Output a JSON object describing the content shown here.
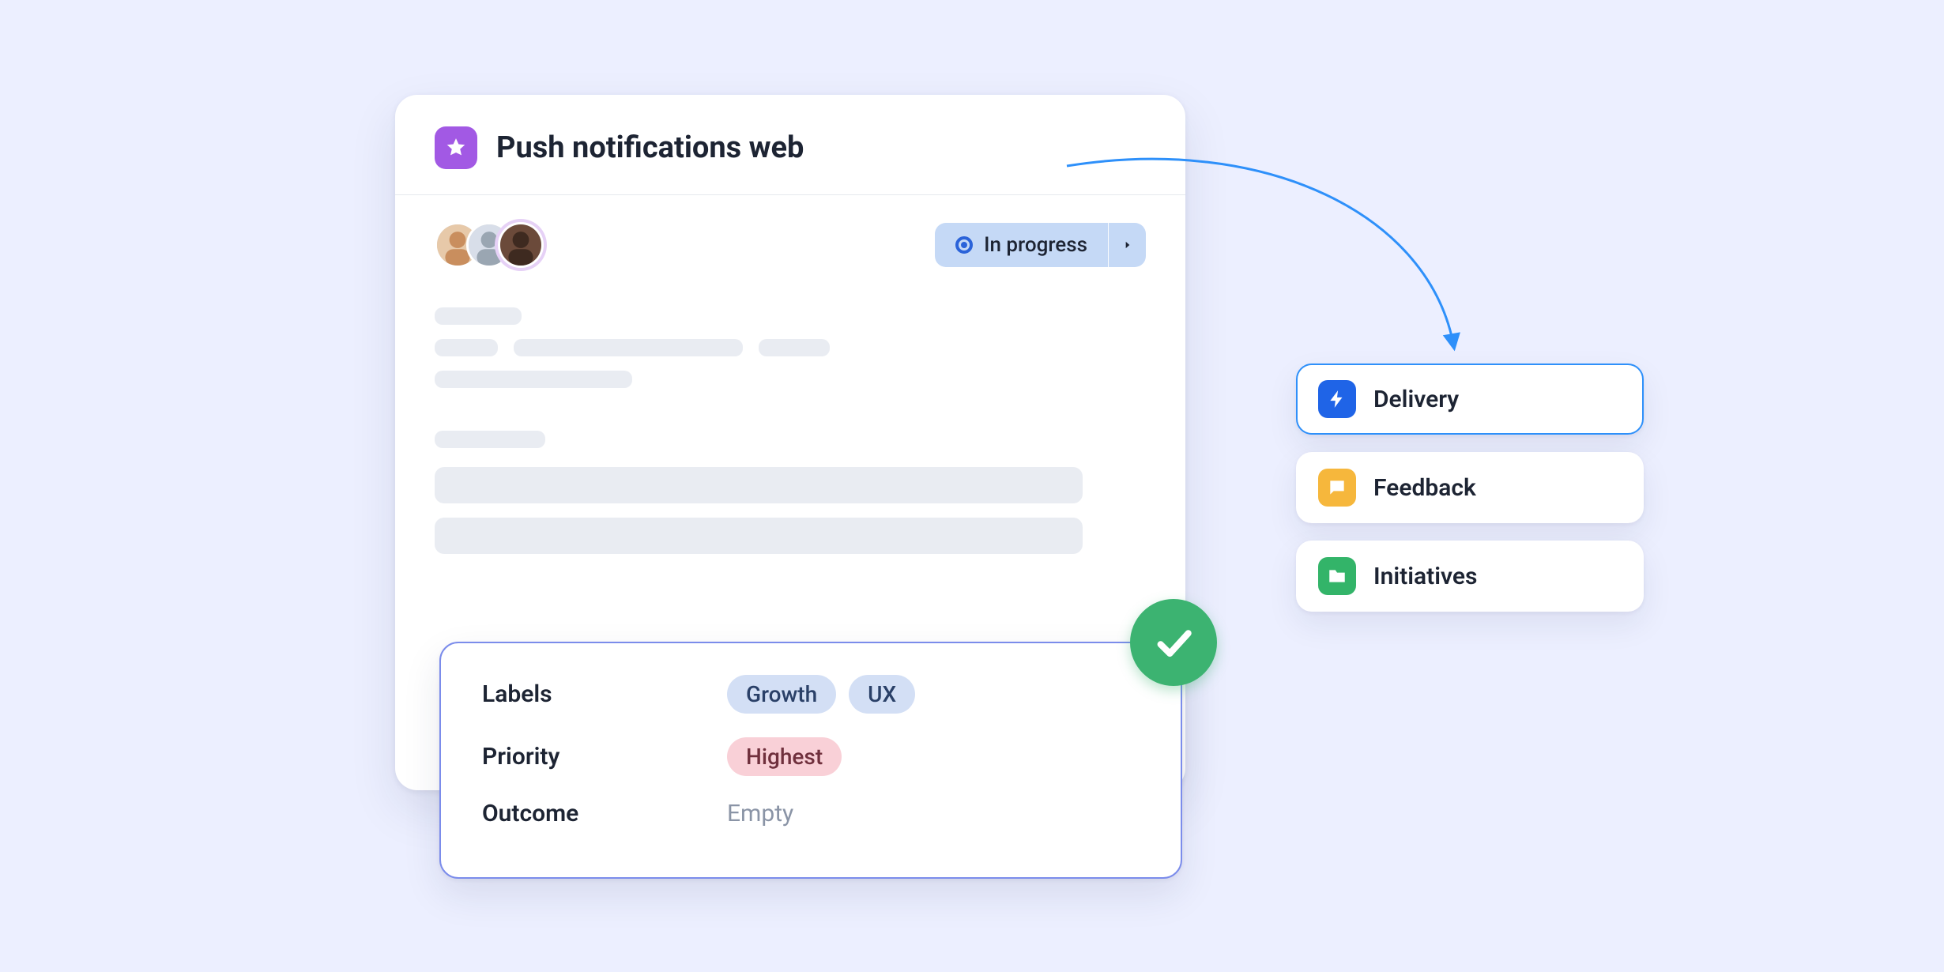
{
  "card": {
    "title": "Push notifications web",
    "status_label": "In progress"
  },
  "properties": {
    "labels_label": "Labels",
    "labels": [
      "Growth",
      "UX"
    ],
    "priority_label": "Priority",
    "priority_value": "Highest",
    "outcome_label": "Outcome",
    "outcome_value": "Empty"
  },
  "destinations": [
    {
      "label": "Delivery",
      "icon": "bolt",
      "color": "blue",
      "selected": true
    },
    {
      "label": "Feedback",
      "icon": "chat",
      "color": "yellow",
      "selected": false
    },
    {
      "label": "Initiatives",
      "icon": "folder",
      "color": "green",
      "selected": false
    }
  ]
}
